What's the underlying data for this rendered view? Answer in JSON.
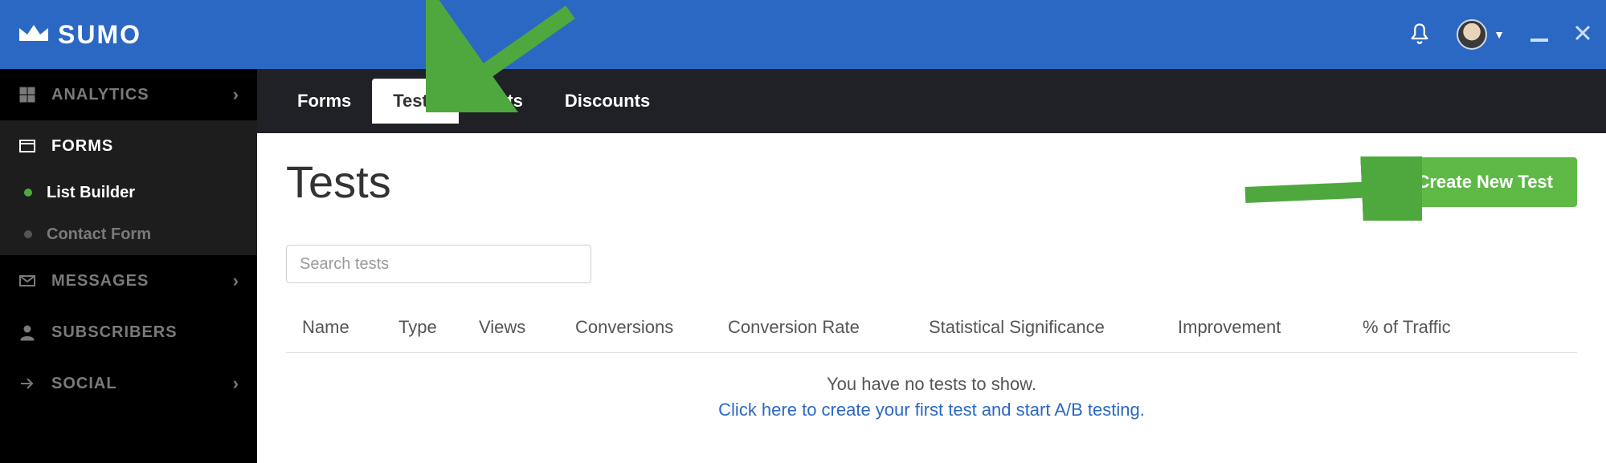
{
  "brand": "SUMO",
  "sidebar": {
    "items": [
      {
        "label": "ANALYTICS"
      },
      {
        "label": "FORMS"
      },
      {
        "label": "MESSAGES"
      },
      {
        "label": "SUBSCRIBERS"
      },
      {
        "label": "SOCIAL"
      }
    ],
    "forms_sub": [
      {
        "label": "List Builder"
      },
      {
        "label": "Contact Form"
      }
    ]
  },
  "tabs": [
    {
      "label": "Forms"
    },
    {
      "label": "Tests"
    },
    {
      "label": "Stats"
    },
    {
      "label": "Discounts"
    }
  ],
  "page": {
    "title": "Tests",
    "create_btn": "Create New Test",
    "search_placeholder": "Search tests"
  },
  "columns": [
    "Name",
    "Type",
    "Views",
    "Conversions",
    "Conversion Rate",
    "Statistical Significance",
    "Improvement",
    "% of Traffic"
  ],
  "empty": {
    "line1": "You have no tests to show.",
    "line2": "Click here to create your first test and start A/B testing."
  }
}
